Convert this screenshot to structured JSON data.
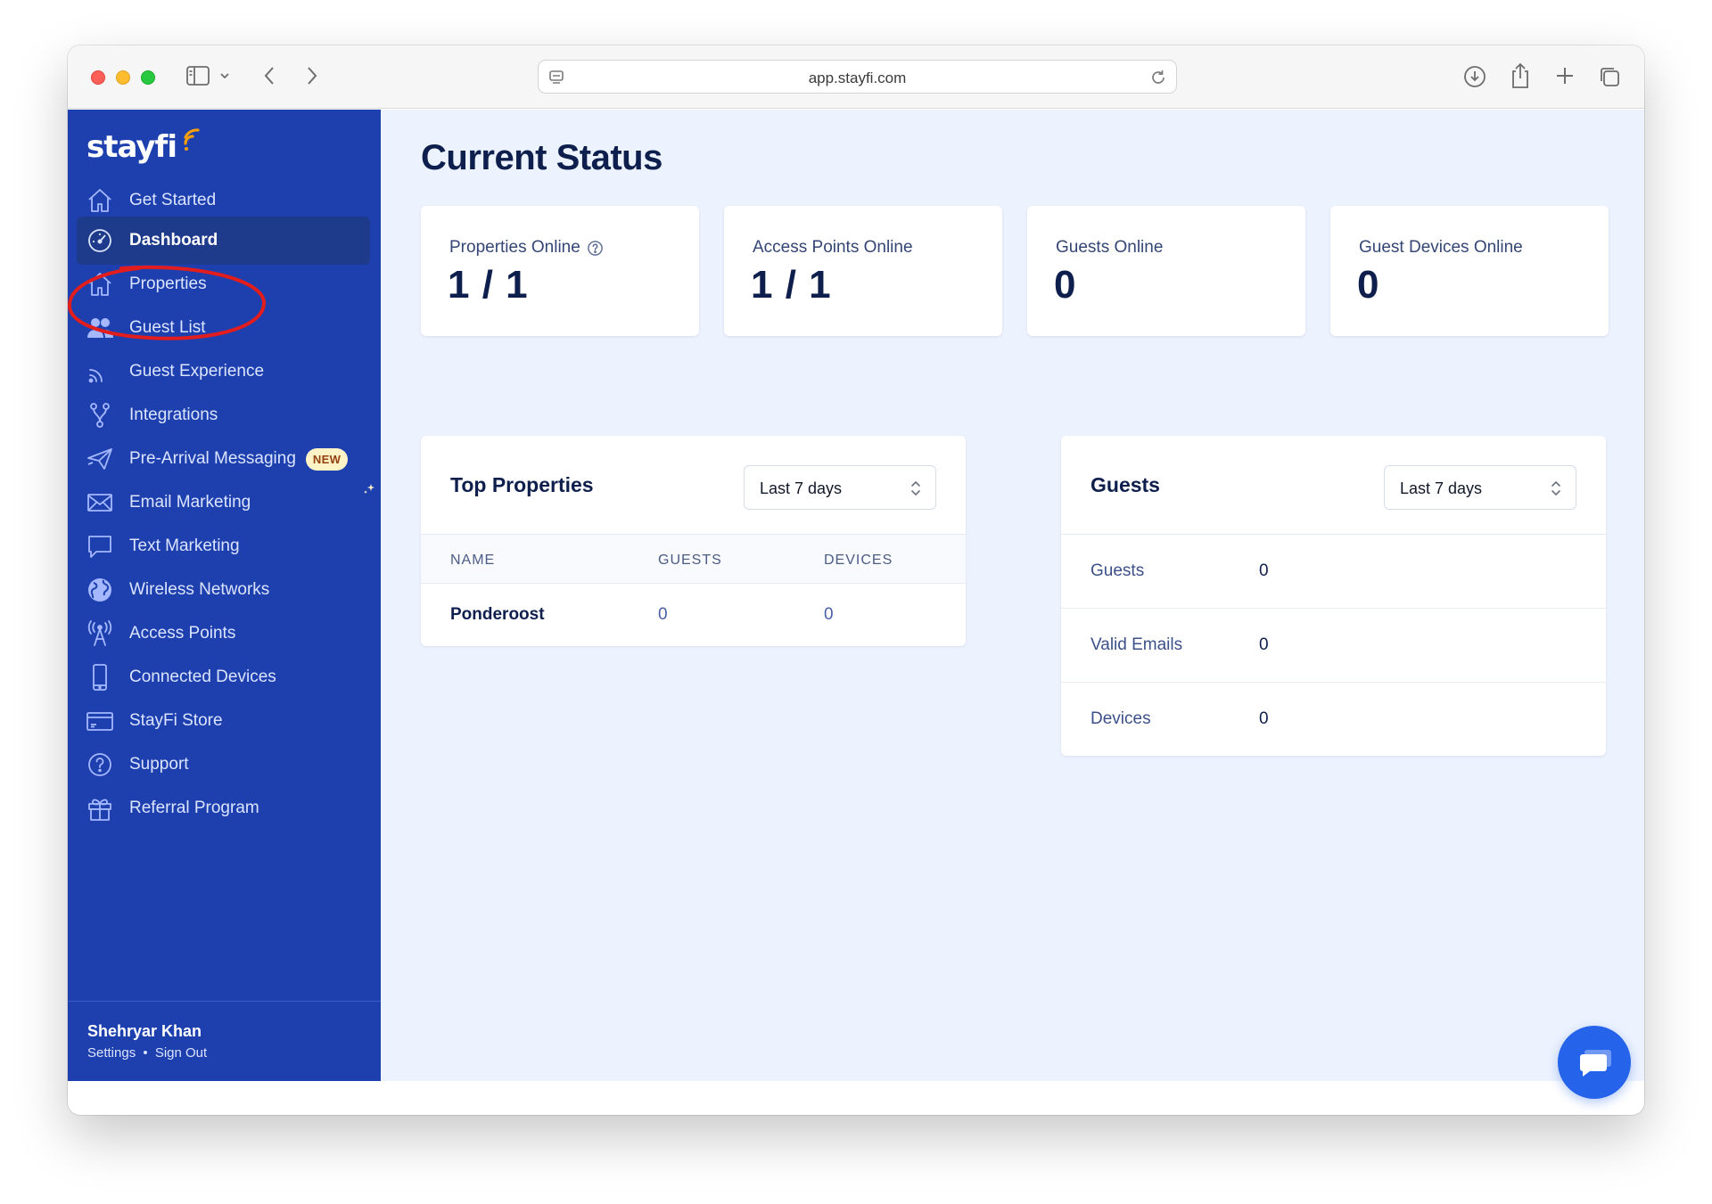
{
  "browser": {
    "url": "app.stayfi.com"
  },
  "sidebar": {
    "logo": "stayfi",
    "items": [
      {
        "label": "Get Started",
        "icon": "house-icon"
      },
      {
        "label": "Dashboard",
        "icon": "gauge-icon",
        "active": true
      },
      {
        "label": "Properties",
        "icon": "house-icon"
      },
      {
        "label": "Guest List",
        "icon": "users-icon"
      },
      {
        "label": "Guest Experience",
        "icon": "signal-icon"
      },
      {
        "label": "Integrations",
        "icon": "integrations-icon"
      },
      {
        "label": "Pre-Arrival Messaging",
        "icon": "paper-plane-icon",
        "badge": "NEW"
      },
      {
        "label": "Email Marketing",
        "icon": "envelope-icon"
      },
      {
        "label": "Text Marketing",
        "icon": "chat-bubble-icon"
      },
      {
        "label": "Wireless Networks",
        "icon": "globe-icon"
      },
      {
        "label": "Access Points",
        "icon": "antenna-icon"
      },
      {
        "label": "Connected Devices",
        "icon": "phone-icon"
      },
      {
        "label": "StayFi Store",
        "icon": "credit-card-icon"
      },
      {
        "label": "Support",
        "icon": "question-circle-icon"
      },
      {
        "label": "Referral Program",
        "icon": "gift-icon"
      }
    ],
    "user": {
      "name": "Shehryar Khan",
      "settings": "Settings",
      "separator": "•",
      "signout": "Sign Out"
    }
  },
  "main": {
    "title": "Current Status",
    "stats": [
      {
        "label": "Properties Online",
        "value": "1 / 1"
      },
      {
        "label": "Access Points Online",
        "value": "1 / 1"
      },
      {
        "label": "Guests Online",
        "value": "0"
      },
      {
        "label": "Guest Devices Online",
        "value": "0"
      }
    ],
    "top_properties": {
      "title": "Top Properties",
      "range": "Last 7 days",
      "columns": [
        "NAME",
        "GUESTS",
        "DEVICES"
      ],
      "rows": [
        {
          "name": "Ponderoost",
          "guests": "0",
          "devices": "0"
        }
      ]
    },
    "guests": {
      "title": "Guests",
      "range": "Last 7 days",
      "rows": [
        {
          "label": "Guests",
          "value": "0"
        },
        {
          "label": "Valid Emails",
          "value": "0"
        },
        {
          "label": "Devices",
          "value": "0"
        }
      ]
    }
  },
  "colors": {
    "sidebar": "#1e40af",
    "sidebar_active": "#1e3a8a",
    "main_bg": "#edf3fe",
    "chat_button": "#2563eb",
    "annotation": "#e11d1d"
  }
}
